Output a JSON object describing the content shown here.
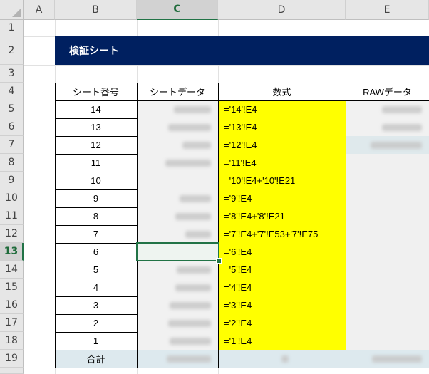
{
  "columns": [
    "A",
    "B",
    "C",
    "D",
    "E"
  ],
  "selected_column": "C",
  "rows": [
    "1",
    "2",
    "3",
    "4",
    "5",
    "6",
    "7",
    "8",
    "9",
    "10",
    "11",
    "12",
    "13",
    "14",
    "15",
    "16",
    "17",
    "18",
    "19",
    "20"
  ],
  "selected_row": "13",
  "title": "検証シート",
  "headers": {
    "sheet_no": "シート番号",
    "sheet_data": "シートデータ",
    "formula": "数式",
    "raw_data": "RAWデータ"
  },
  "data_rows": [
    {
      "sheet_no": "14",
      "formula": "='14'!E4"
    },
    {
      "sheet_no": "13",
      "formula": "='13'!E4"
    },
    {
      "sheet_no": "12",
      "formula": "='12'!E4"
    },
    {
      "sheet_no": "11",
      "formula": "='11'!E4"
    },
    {
      "sheet_no": "10",
      "formula": "='10'!E4+'10'!E21"
    },
    {
      "sheet_no": "9",
      "formula": "='9'!E4"
    },
    {
      "sheet_no": "8",
      "formula": "='8'!E4+'8'!E21"
    },
    {
      "sheet_no": "7",
      "formula": "='7'!E4+'7'!E53+'7'!E75"
    },
    {
      "sheet_no": "6",
      "formula": "='6'!E4"
    },
    {
      "sheet_no": "5",
      "formula": "='5'!E4"
    },
    {
      "sheet_no": "4",
      "formula": "='4'!E4"
    },
    {
      "sheet_no": "3",
      "formula": "='3'!E4"
    },
    {
      "sheet_no": "2",
      "formula": "='2'!E4"
    },
    {
      "sheet_no": "1",
      "formula": "='1'!E4"
    }
  ],
  "total_label": "合計",
  "colors": {
    "banner": "#002060",
    "formula_fill": "#ffff00",
    "total_fill": "#dde9ee",
    "selection": "#217346"
  }
}
